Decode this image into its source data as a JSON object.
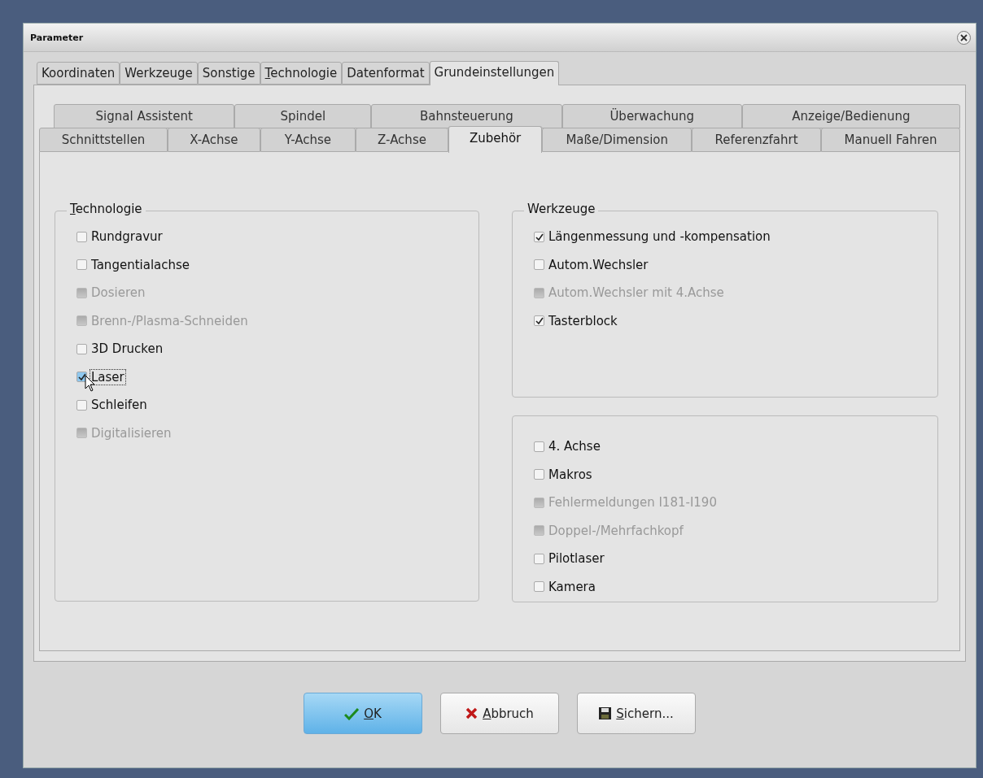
{
  "window": {
    "title": "Parameter"
  },
  "tabs": [
    {
      "label": "Koordinaten",
      "selected": false,
      "underline_first": false
    },
    {
      "label": "Werkzeuge",
      "selected": false,
      "underline_first": false
    },
    {
      "label": "Sonstige",
      "selected": false,
      "underline_first": false
    },
    {
      "label": "Technologie",
      "selected": false,
      "underline_first": true
    },
    {
      "label": "Datenformat",
      "selected": false,
      "underline_first": false
    },
    {
      "label": "Grundeinstellungen",
      "selected": true,
      "underline_first": false
    }
  ],
  "subtabs_rows": [
    [
      {
        "label": "Signal Assistent",
        "selected": false
      },
      {
        "label": "Spindel",
        "selected": false
      },
      {
        "label": "Bahnsteuerung",
        "selected": false
      },
      {
        "label": "Überwachung",
        "selected": false
      },
      {
        "label": "Anzeige/Bedienung",
        "selected": false
      }
    ],
    [
      {
        "label": "Schnittstellen",
        "selected": false
      },
      {
        "label": "X-Achse",
        "selected": false
      },
      {
        "label": "Y-Achse",
        "selected": false
      },
      {
        "label": "Z-Achse",
        "selected": false
      },
      {
        "label": "Zubehör",
        "selected": true
      },
      {
        "label": "Maße/Dimension",
        "selected": false
      },
      {
        "label": "Referenzfahrt",
        "selected": false
      },
      {
        "label": "Manuell Fahren",
        "selected": false
      }
    ]
  ],
  "groups": [
    {
      "title": "Technologie",
      "underline_first": true,
      "items": [
        {
          "label": "Rundgravur",
          "checked": false,
          "disabled": false,
          "focused": false
        },
        {
          "label": "Tangentialachse",
          "checked": false,
          "disabled": false,
          "focused": false
        },
        {
          "label": "Dosieren",
          "checked": false,
          "disabled": true,
          "focused": false
        },
        {
          "label": "Brenn-/Plasma-Schneiden",
          "checked": false,
          "disabled": true,
          "focused": false
        },
        {
          "label": "3D Drucken",
          "checked": false,
          "disabled": false,
          "focused": false
        },
        {
          "label": "Laser",
          "checked": true,
          "disabled": false,
          "focused": true
        },
        {
          "label": "Schleifen",
          "checked": false,
          "disabled": false,
          "focused": false
        },
        {
          "label": "Digitalisieren",
          "checked": false,
          "disabled": true,
          "focused": false
        }
      ]
    },
    {
      "title": "Werkzeuge",
      "underline_first": false,
      "items": [
        {
          "label": "Längenmessung und -kompensation",
          "checked": true,
          "disabled": false,
          "focused": false
        },
        {
          "label": "Autom.Wechsler",
          "checked": false,
          "disabled": false,
          "focused": false
        },
        {
          "label": "Autom.Wechsler mit 4.Achse",
          "checked": false,
          "disabled": true,
          "focused": false
        },
        {
          "label": "Tasterblock",
          "checked": true,
          "disabled": false,
          "focused": false
        }
      ]
    },
    {
      "items": [
        {
          "label": "4. Achse",
          "checked": false,
          "disabled": false,
          "focused": false
        },
        {
          "label": "Makros",
          "checked": false,
          "disabled": false,
          "focused": false
        },
        {
          "label": "Fehlermeldungen I181-I190",
          "checked": false,
          "disabled": true,
          "focused": false
        },
        {
          "label": "Doppel-/Mehrfachkopf",
          "checked": false,
          "disabled": true,
          "focused": false
        },
        {
          "label": "Pilotlaser",
          "checked": false,
          "disabled": false,
          "focused": false
        },
        {
          "label": "Kamera",
          "checked": false,
          "disabled": false,
          "focused": false
        }
      ]
    }
  ],
  "buttons": [
    {
      "label": "OK",
      "kind": "ok",
      "default": true,
      "underline_first": true
    },
    {
      "label": "Abbruch",
      "kind": "cancel",
      "default": false,
      "underline_first": true
    },
    {
      "label": "Sichern...",
      "kind": "save",
      "default": false,
      "underline_first": true
    }
  ]
}
